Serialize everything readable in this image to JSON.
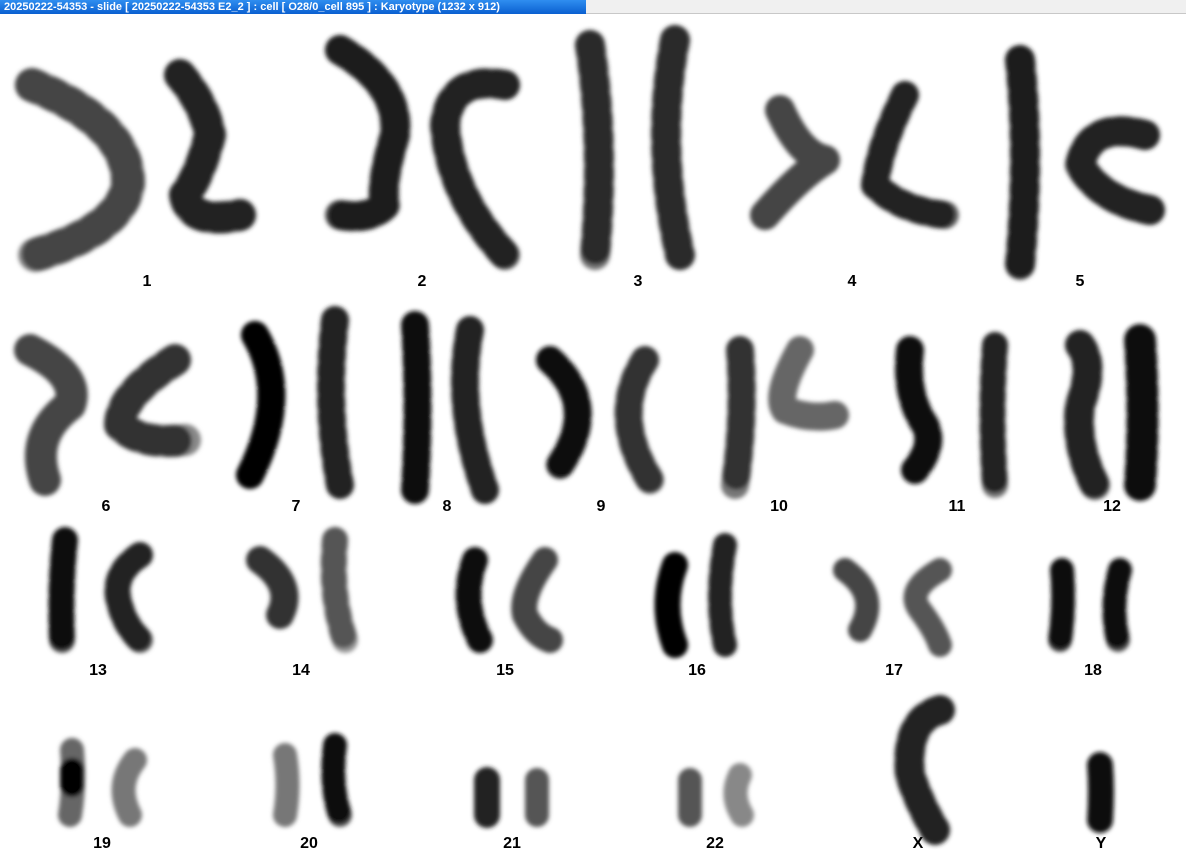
{
  "window": {
    "title": "20250222-54353 - slide [ 20250222-54353 E2_2 ] : cell [ O28/0_cell 895 ] : Karyotype  (1232 x 912)"
  },
  "karyotype": {
    "labels": [
      "1",
      "2",
      "3",
      "4",
      "5",
      "6",
      "7",
      "8",
      "9",
      "10",
      "11",
      "12",
      "13",
      "14",
      "15",
      "16",
      "17",
      "18",
      "19",
      "20",
      "21",
      "22",
      "X",
      "Y"
    ]
  }
}
